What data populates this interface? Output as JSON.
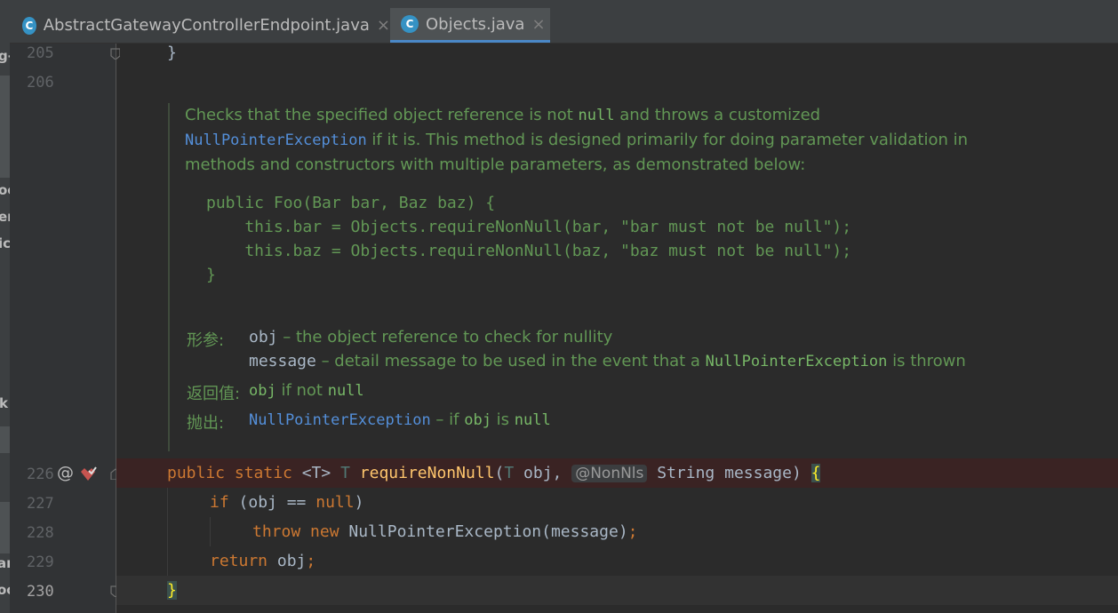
{
  "tabs": [
    {
      "label": "AbstractGatewayControllerEndpoint.java",
      "icon": "class-icon",
      "glyph": "C",
      "active": false,
      "close": "×"
    },
    {
      "label": "Objects.java",
      "icon": "class-icon",
      "glyph": "C",
      "active": true,
      "close": "×"
    }
  ],
  "left_strip_fragments": [
    "g-",
    "oc",
    "er",
    "ic",
    "k",
    "ar",
    "oc"
  ],
  "gutter": {
    "lines": [
      "205",
      "206",
      "226",
      "227",
      "228",
      "229",
      "230"
    ],
    "gutter_symbols": {
      "at": "@"
    }
  },
  "code": {
    "line205": "}",
    "line226": {
      "kw1": "public static ",
      "generic": "<T> ",
      "type": "T ",
      "method": "requireNonNull",
      "paren_open": "(",
      "param_type": "T ",
      "param1": "obj, ",
      "annotation": "@NonNls",
      "param2": " String message) ",
      "brace": "{"
    },
    "line227": {
      "kw": "if",
      "rest": " (obj == ",
      "null_kw": "null",
      "close": ")"
    },
    "line228": {
      "kw1": "throw",
      "sp": " ",
      "kw2": "new",
      "rest": " NullPointerException(message)",
      "semi": ";"
    },
    "line229": {
      "kw": "return",
      "rest": " obj",
      "semi": ";"
    },
    "line230": "}"
  },
  "doc": {
    "p1_a": "Checks that the specified object reference is not ",
    "p1_null": "null",
    "p1_b": " and throws a customized",
    "p2_link": "NullPointerException",
    "p2_b": " if it is. This method is designed primarily for doing parameter validation in",
    "p3": "methods and constructors with multiple parameters, as demonstrated below:",
    "example": "public Foo(Bar bar, Baz baz) {\n    this.bar = Objects.requireNonNull(bar, \"bar must not be null\");\n    this.baz = Objects.requireNonNull(baz, \"baz must not be null\");\n}",
    "params_label": "形参:",
    "param1_name": "obj",
    "param1_desc": " – the object reference to check for nullity",
    "param2_name": "message",
    "param2_desc": " – detail message to be used in the event that a ",
    "param2_link": "NullPointerException",
    "param2_tail": " is thrown",
    "returns_label": "返回值:",
    "returns_obj": "obj",
    "returns_mid": " if not ",
    "returns_null": "null",
    "throws_label": "抛出:",
    "throws_link": "NullPointerException",
    "throws_mid": " – if ",
    "throws_obj": "obj",
    "throws_is": " is ",
    "throws_null": "null"
  },
  "colors": {
    "keyword": "#cc7832",
    "method": "#ffc66d",
    "doc_text": "#629755",
    "link": "#548fd9",
    "breakpoint": "#c75450"
  }
}
